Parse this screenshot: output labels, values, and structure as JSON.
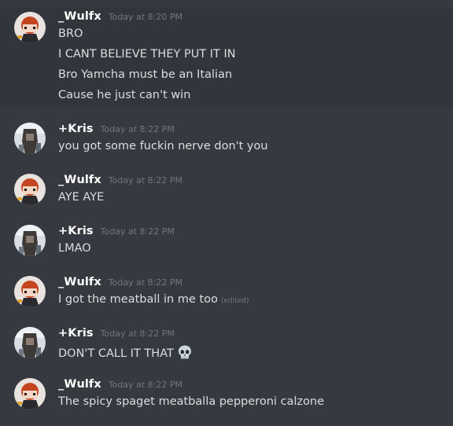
{
  "messages": [
    {
      "username": "_Wulfx",
      "timestamp": "Today at 8:20 PM",
      "lines": [
        "BRO",
        "I CANT BELIEVE THEY PUT IT IN",
        "Bro Yamcha must be an Italian",
        "Cause he just can't win"
      ]
    },
    {
      "username": "+Kris",
      "timestamp": "Today at 8:22 PM",
      "lines": [
        "you got some fuckin nerve don't you"
      ]
    },
    {
      "username": "_Wulfx",
      "timestamp": "Today at 8:22 PM",
      "lines": [
        "AYE AYE"
      ]
    },
    {
      "username": "+Kris",
      "timestamp": "Today at 8:22 PM",
      "lines": [
        "LMAO"
      ]
    },
    {
      "username": "_Wulfx",
      "timestamp": "Today at 8:22 PM",
      "lines": [
        "I got the meatball in me too"
      ],
      "edited": "(edited)"
    },
    {
      "username": "+Kris",
      "timestamp": "Today at 8:22 PM",
      "lines": [
        "DON'T CALL IT THAT"
      ],
      "emoji": "skull-icon"
    },
    {
      "username": "_Wulfx",
      "timestamp": "Today at 8:22 PM",
      "lines": [
        "The spicy spaget meatballa pepperoni calzone"
      ]
    }
  ]
}
